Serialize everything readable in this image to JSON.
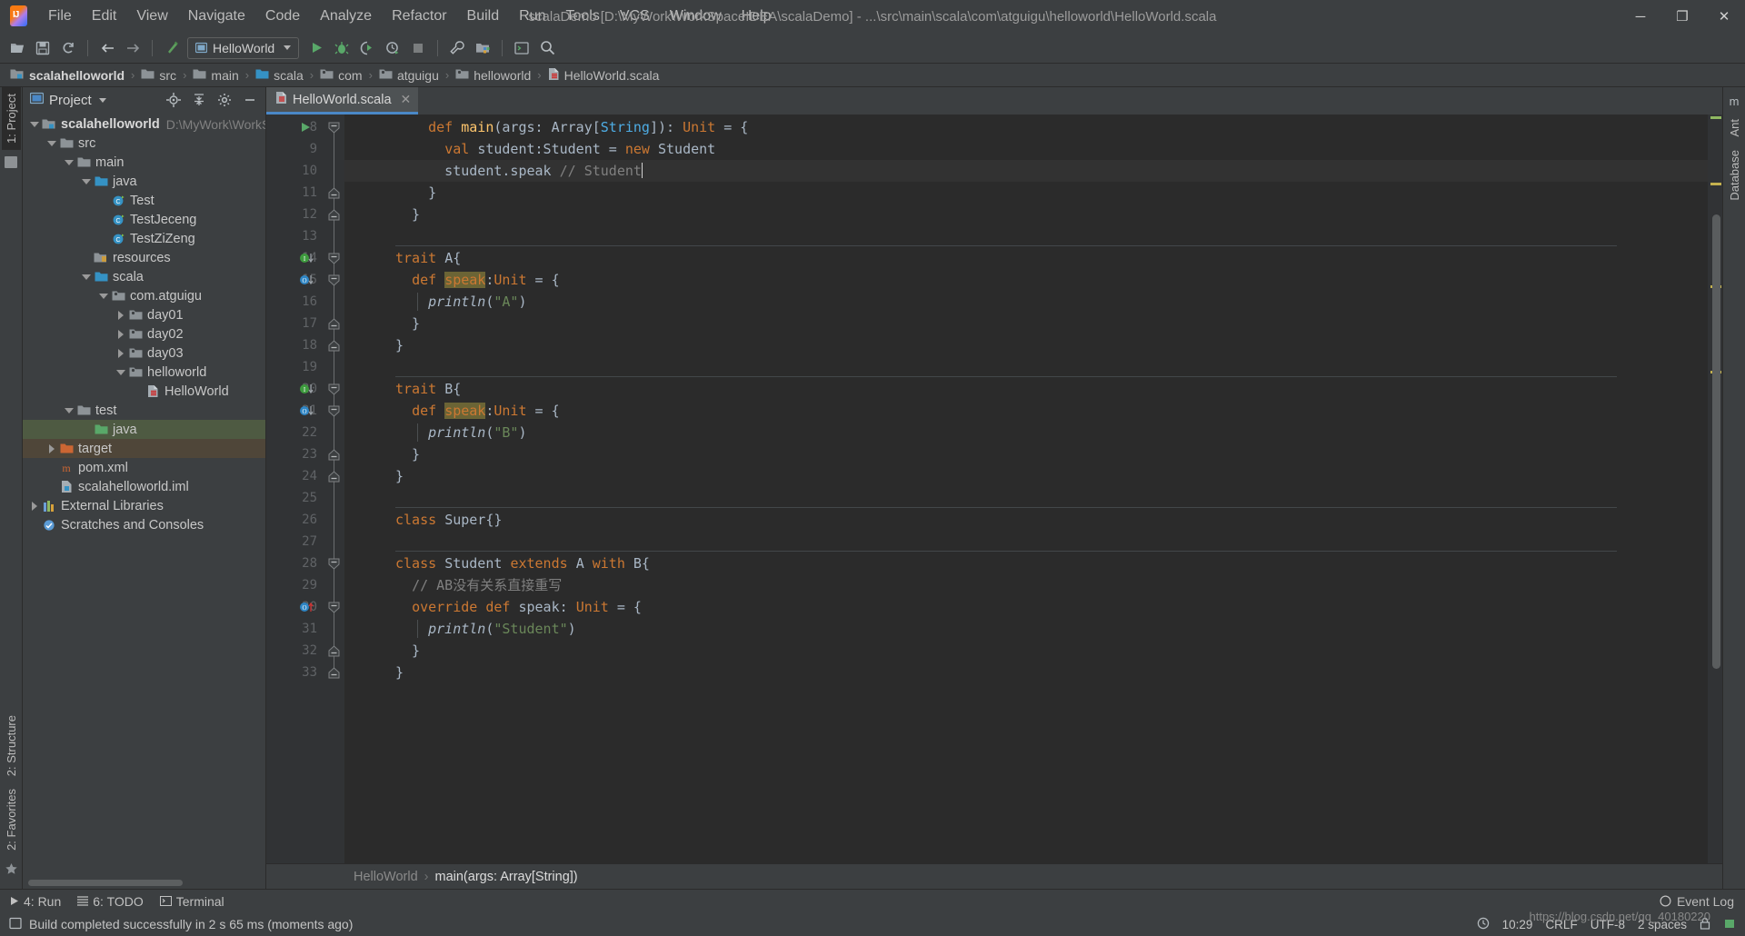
{
  "window": {
    "title": "scalaDemo [D:\\MyWork\\WorkSpaceIDEA\\scalaDemo] - ...\\src\\main\\scala\\com\\atguigu\\helloworld\\HelloWorld.scala",
    "minimize": "─",
    "maximize": "❐",
    "close": "✕"
  },
  "menu": [
    {
      "label": "File"
    },
    {
      "label": "Edit"
    },
    {
      "label": "View"
    },
    {
      "label": "Navigate"
    },
    {
      "label": "Code"
    },
    {
      "label": "Analyze"
    },
    {
      "label": "Refactor"
    },
    {
      "label": "Build"
    },
    {
      "label": "Run"
    },
    {
      "label": "Tools"
    },
    {
      "label": "VCS"
    },
    {
      "label": "Window"
    },
    {
      "label": "Help"
    }
  ],
  "toolbar": {
    "open_icon": "open-folder-icon",
    "save_icon": "save-icon",
    "sync_icon": "refresh-icon",
    "back_icon": "back-arrow-icon",
    "forward_icon": "forward-arrow-icon",
    "build_icon": "build-hammer-icon",
    "run_config": "HelloWorld",
    "run_icon": "run-icon",
    "debug_icon": "debug-icon",
    "run_coverage_icon": "run-with-coverage-icon",
    "profile_icon": "profiler-icon",
    "stop_icon": "stop-icon",
    "settings_icon": "wrench-icon",
    "project_structure_icon": "project-structure-icon",
    "terminal_icon": "terminal-icon",
    "search_icon": "search-everywhere-icon"
  },
  "breadcrumb": [
    {
      "label": "scalahelloworld",
      "icon": "module-icon"
    },
    {
      "label": "src",
      "icon": "folder-icon"
    },
    {
      "label": "main",
      "icon": "folder-icon"
    },
    {
      "label": "scala",
      "icon": "source-folder-icon"
    },
    {
      "label": "com",
      "icon": "package-icon"
    },
    {
      "label": "atguigu",
      "icon": "package-icon"
    },
    {
      "label": "helloworld",
      "icon": "package-icon"
    },
    {
      "label": "HelloWorld.scala",
      "icon": "scala-file-icon"
    }
  ],
  "left_strip": [
    {
      "label": "1: Project",
      "active": true
    },
    {
      "label": "2: Structure",
      "active": false
    },
    {
      "label": "2: Favorites",
      "active": false
    }
  ],
  "right_strip": [
    {
      "label": "m",
      "name": "maven-icon"
    },
    {
      "label": "Ant",
      "name": "ant-icon"
    },
    {
      "label": "Database",
      "name": "database-icon"
    }
  ],
  "project_panel": {
    "title": "Project",
    "locate_icon": "locate-file-icon",
    "collapse_icon": "collapse-all-icon",
    "minimize_icon": "hide-panel-icon",
    "settings_icon": "gear-icon",
    "tree": [
      {
        "label": "scalahelloworld",
        "path": "D:\\MyWork\\WorkSpac",
        "depth": 0,
        "twisty": "down",
        "icon": "module-icon",
        "bold": true,
        "sel": ""
      },
      {
        "label": "src",
        "path": "",
        "depth": 1,
        "twisty": "down",
        "icon": "folder-icon",
        "bold": false,
        "sel": ""
      },
      {
        "label": "main",
        "path": "",
        "depth": 2,
        "twisty": "down",
        "icon": "folder-icon",
        "bold": false,
        "sel": ""
      },
      {
        "label": "java",
        "path": "",
        "depth": 3,
        "twisty": "down",
        "icon": "source-folder-icon",
        "bold": false,
        "sel": ""
      },
      {
        "label": "Test",
        "path": "",
        "depth": 4,
        "twisty": "none",
        "icon": "scala-class-icon",
        "bold": false,
        "sel": ""
      },
      {
        "label": "TestJeceng",
        "path": "",
        "depth": 4,
        "twisty": "none",
        "icon": "scala-class-icon",
        "bold": false,
        "sel": ""
      },
      {
        "label": "TestZiZeng",
        "path": "",
        "depth": 4,
        "twisty": "none",
        "icon": "scala-class-icon",
        "bold": false,
        "sel": ""
      },
      {
        "label": "resources",
        "path": "",
        "depth": 3,
        "twisty": "none",
        "icon": "resources-folder-icon",
        "bold": false,
        "sel": ""
      },
      {
        "label": "scala",
        "path": "",
        "depth": 3,
        "twisty": "down",
        "icon": "source-folder-icon",
        "bold": false,
        "sel": ""
      },
      {
        "label": "com.atguigu",
        "path": "",
        "depth": 4,
        "twisty": "down",
        "icon": "package-icon",
        "bold": false,
        "sel": ""
      },
      {
        "label": "day01",
        "path": "",
        "depth": 5,
        "twisty": "right",
        "icon": "package-icon",
        "bold": false,
        "sel": ""
      },
      {
        "label": "day02",
        "path": "",
        "depth": 5,
        "twisty": "right",
        "icon": "package-icon",
        "bold": false,
        "sel": ""
      },
      {
        "label": "day03",
        "path": "",
        "depth": 5,
        "twisty": "right",
        "icon": "package-icon",
        "bold": false,
        "sel": ""
      },
      {
        "label": "helloworld",
        "path": "",
        "depth": 5,
        "twisty": "down",
        "icon": "package-icon",
        "bold": false,
        "sel": ""
      },
      {
        "label": "HelloWorld",
        "path": "",
        "depth": 6,
        "twisty": "none",
        "icon": "scala-file-icon",
        "bold": false,
        "sel": ""
      },
      {
        "label": "test",
        "path": "",
        "depth": 2,
        "twisty": "down",
        "icon": "folder-icon",
        "bold": false,
        "sel": ""
      },
      {
        "label": "java",
        "path": "",
        "depth": 3,
        "twisty": "none",
        "icon": "test-source-folder-icon",
        "bold": false,
        "sel": "sel-green"
      },
      {
        "label": "target",
        "path": "",
        "depth": 1,
        "twisty": "right",
        "icon": "excluded-folder-icon",
        "bold": false,
        "sel": "sel-brown"
      },
      {
        "label": "pom.xml",
        "path": "",
        "depth": 1,
        "twisty": "none",
        "icon": "maven-file-icon",
        "bold": false,
        "sel": ""
      },
      {
        "label": "scalahelloworld.iml",
        "path": "",
        "depth": 1,
        "twisty": "none",
        "icon": "iml-file-icon",
        "bold": false,
        "sel": ""
      },
      {
        "label": "External Libraries",
        "path": "",
        "depth": 0,
        "twisty": "right",
        "icon": "libraries-icon",
        "bold": false,
        "sel": ""
      },
      {
        "label": "Scratches and Consoles",
        "path": "",
        "depth": 0,
        "twisty": "none",
        "icon": "scratches-icon",
        "bold": false,
        "sel": ""
      }
    ]
  },
  "editor": {
    "tab": {
      "label": "HelloWorld.scala",
      "icon": "scala-file-icon",
      "close": "✕"
    },
    "first_line_number": 8,
    "lines": [
      {
        "n": 8,
        "gutter_icon": "run-gutter-icon",
        "fold": "fold-start",
        "highlight": false,
        "tokens": [
          {
            "t": "    ",
            "c": ""
          },
          {
            "t": "def ",
            "c": "kw"
          },
          {
            "t": "main",
            "c": "fn"
          },
          {
            "t": "(args: ",
            "c": "id"
          },
          {
            "t": "Array",
            "c": "id"
          },
          {
            "t": "[",
            "c": "id"
          },
          {
            "t": "String",
            "c": "tparam"
          },
          {
            "t": "]): ",
            "c": "id"
          },
          {
            "t": "Unit",
            "c": "kw"
          },
          {
            "t": " = {",
            "c": "id"
          }
        ]
      },
      {
        "n": 9,
        "gutter_icon": "",
        "fold": "",
        "highlight": false,
        "tokens": [
          {
            "t": "      ",
            "c": ""
          },
          {
            "t": "val ",
            "c": "kw"
          },
          {
            "t": "student:Student = ",
            "c": "id"
          },
          {
            "t": "new ",
            "c": "kw"
          },
          {
            "t": "Student",
            "c": "id"
          }
        ]
      },
      {
        "n": 10,
        "gutter_icon": "",
        "fold": "",
        "highlight": true,
        "tokens": [
          {
            "t": "      student.speak ",
            "c": "id"
          },
          {
            "t": "// Student",
            "c": "cmt"
          },
          {
            "t": "|",
            "c": "caret"
          }
        ]
      },
      {
        "n": 11,
        "gutter_icon": "",
        "fold": "fold-end",
        "highlight": false,
        "tokens": [
          {
            "t": "    }",
            "c": "id"
          }
        ]
      },
      {
        "n": 12,
        "gutter_icon": "",
        "fold": "fold-end",
        "highlight": false,
        "tokens": [
          {
            "t": "  }",
            "c": "id"
          }
        ]
      },
      {
        "n": 13,
        "gutter_icon": "",
        "fold": "",
        "highlight": false,
        "tokens": []
      },
      {
        "n": 14,
        "gutter_icon": "implemented-icon",
        "fold": "fold-start",
        "highlight": false,
        "separator": true,
        "tokens": [
          {
            "t": "trait ",
            "c": "kw"
          },
          {
            "t": "A{",
            "c": "id"
          }
        ]
      },
      {
        "n": 15,
        "gutter_icon": "overridden-icon",
        "fold": "fold-start",
        "highlight": false,
        "tokens": [
          {
            "t": "  ",
            "c": ""
          },
          {
            "t": "def ",
            "c": "kw"
          },
          {
            "t": "speak",
            "c": "hl"
          },
          {
            "t": ":",
            "c": "id"
          },
          {
            "t": "Unit",
            "c": "kw"
          },
          {
            "t": " = {",
            "c": "id"
          }
        ]
      },
      {
        "n": 16,
        "gutter_icon": "",
        "fold": "",
        "highlight": false,
        "tokens": [
          {
            "t": "    ",
            "c": ""
          },
          {
            "t": "println",
            "c": "italic"
          },
          {
            "t": "(",
            "c": "id"
          },
          {
            "t": "\"A\"",
            "c": "str"
          },
          {
            "t": ")",
            "c": "id"
          }
        ]
      },
      {
        "n": 17,
        "gutter_icon": "",
        "fold": "fold-end",
        "highlight": false,
        "tokens": [
          {
            "t": "  }",
            "c": "id"
          }
        ]
      },
      {
        "n": 18,
        "gutter_icon": "",
        "fold": "fold-end",
        "highlight": false,
        "tokens": [
          {
            "t": "}",
            "c": "id"
          }
        ]
      },
      {
        "n": 19,
        "gutter_icon": "",
        "fold": "",
        "highlight": false,
        "tokens": []
      },
      {
        "n": 20,
        "gutter_icon": "implemented-icon",
        "fold": "fold-start",
        "highlight": false,
        "separator": true,
        "tokens": [
          {
            "t": "trait ",
            "c": "kw"
          },
          {
            "t": "B{",
            "c": "id"
          }
        ]
      },
      {
        "n": 21,
        "gutter_icon": "overridden-icon",
        "fold": "fold-start",
        "highlight": false,
        "tokens": [
          {
            "t": "  ",
            "c": ""
          },
          {
            "t": "def ",
            "c": "kw"
          },
          {
            "t": "speak",
            "c": "hl"
          },
          {
            "t": ":",
            "c": "id"
          },
          {
            "t": "Unit",
            "c": "kw"
          },
          {
            "t": " = {",
            "c": "id"
          }
        ]
      },
      {
        "n": 22,
        "gutter_icon": "",
        "fold": "",
        "highlight": false,
        "tokens": [
          {
            "t": "    ",
            "c": ""
          },
          {
            "t": "println",
            "c": "italic"
          },
          {
            "t": "(",
            "c": "id"
          },
          {
            "t": "\"B\"",
            "c": "str"
          },
          {
            "t": ")",
            "c": "id"
          }
        ]
      },
      {
        "n": 23,
        "gutter_icon": "",
        "fold": "fold-end",
        "highlight": false,
        "tokens": [
          {
            "t": "  }",
            "c": "id"
          }
        ]
      },
      {
        "n": 24,
        "gutter_icon": "",
        "fold": "fold-end",
        "highlight": false,
        "tokens": [
          {
            "t": "}",
            "c": "id"
          }
        ]
      },
      {
        "n": 25,
        "gutter_icon": "",
        "fold": "",
        "highlight": false,
        "tokens": []
      },
      {
        "n": 26,
        "gutter_icon": "",
        "fold": "",
        "highlight": false,
        "separator": true,
        "tokens": [
          {
            "t": "class ",
            "c": "kw"
          },
          {
            "t": "Super{}",
            "c": "id"
          }
        ]
      },
      {
        "n": 27,
        "gutter_icon": "",
        "fold": "",
        "highlight": false,
        "tokens": []
      },
      {
        "n": 28,
        "gutter_icon": "",
        "fold": "fold-start",
        "highlight": false,
        "separator": true,
        "tokens": [
          {
            "t": "class ",
            "c": "kw"
          },
          {
            "t": "Student ",
            "c": "id"
          },
          {
            "t": "extends ",
            "c": "kw"
          },
          {
            "t": "A ",
            "c": "id"
          },
          {
            "t": "with ",
            "c": "kw"
          },
          {
            "t": "B{",
            "c": "id"
          }
        ]
      },
      {
        "n": 29,
        "gutter_icon": "",
        "fold": "",
        "highlight": false,
        "tokens": [
          {
            "t": "  ",
            "c": ""
          },
          {
            "t": "// AB没有关系直接重写",
            "c": "cmt"
          }
        ]
      },
      {
        "n": 30,
        "gutter_icon": "overriding-icon",
        "fold": "fold-start",
        "highlight": false,
        "tokens": [
          {
            "t": "  ",
            "c": ""
          },
          {
            "t": "override def ",
            "c": "kw"
          },
          {
            "t": "speak",
            "c": "id"
          },
          {
            "t": ": ",
            "c": "id"
          },
          {
            "t": "Unit",
            "c": "kw"
          },
          {
            "t": " = {",
            "c": "id"
          }
        ]
      },
      {
        "n": 31,
        "gutter_icon": "",
        "fold": "",
        "highlight": false,
        "tokens": [
          {
            "t": "    ",
            "c": ""
          },
          {
            "t": "println",
            "c": "italic"
          },
          {
            "t": "(",
            "c": "id"
          },
          {
            "t": "\"Student\"",
            "c": "str"
          },
          {
            "t": ")",
            "c": "id"
          }
        ]
      },
      {
        "n": 32,
        "gutter_icon": "",
        "fold": "fold-end",
        "highlight": false,
        "tokens": [
          {
            "t": "  }",
            "c": "id"
          }
        ]
      },
      {
        "n": 33,
        "gutter_icon": "",
        "fold": "fold-end",
        "highlight": false,
        "tokens": [
          {
            "t": "}",
            "c": "id"
          }
        ]
      }
    ],
    "bottom_breadcrumb": {
      "class": "HelloWorld",
      "member": "main(args: Array[String])",
      "sep": "›"
    }
  },
  "bottom_tool_window": [
    {
      "label": "4: Run",
      "icon": "run-icon"
    },
    {
      "label": "6: TODO",
      "icon": "todo-icon"
    },
    {
      "label": "Terminal",
      "icon": "terminal-icon"
    }
  ],
  "event_log": {
    "label": "Event Log",
    "icon": "event-log-icon"
  },
  "status": {
    "icon": "build-status-icon",
    "message": "Build completed successfully in 2 s 65 ms (moments ago)",
    "time": "10:29",
    "line_separator": "CRLF",
    "encoding": "UTF-8",
    "indent": "2 spaces",
    "clock_icon": "clock-icon",
    "lock_icon": "lock-icon",
    "notification_icon": "notification-icon"
  },
  "watermark": "https://blog.csdn.net/qq_40180220",
  "colors": {
    "accent_blue": "#4a88c7",
    "keyword_orange": "#cc7832",
    "string_green": "#6a8759",
    "method_yellow": "#ffc66d",
    "comment_gray": "#808080",
    "identifier": "#a9b7c6",
    "editor_bg": "#2b2b2b",
    "panel_bg": "#3c3f41",
    "selection_green": "#4e5a42",
    "selection_brown": "#4f4639",
    "highlight_olive": "#6b6435"
  }
}
